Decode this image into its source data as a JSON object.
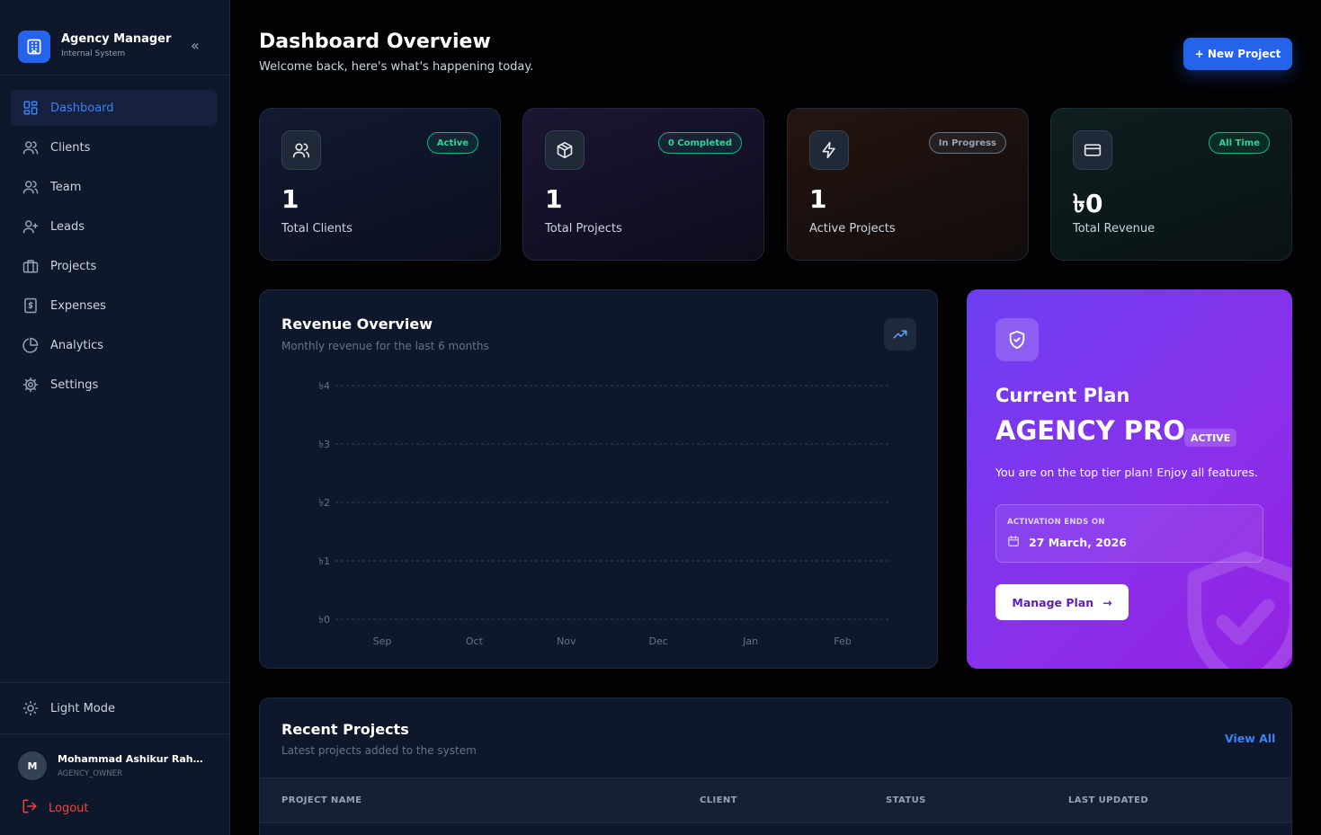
{
  "brand": {
    "title": "Agency Manager",
    "subtitle": "Internal System",
    "collapse_glyph": "«"
  },
  "nav": [
    {
      "label": "Dashboard",
      "icon": "dashboard-icon"
    },
    {
      "label": "Clients",
      "icon": "users-icon"
    },
    {
      "label": "Team",
      "icon": "users-icon"
    },
    {
      "label": "Leads",
      "icon": "user-plus-icon"
    },
    {
      "label": "Projects",
      "icon": "briefcase-icon"
    },
    {
      "label": "Expenses",
      "icon": "receipt-icon"
    },
    {
      "label": "Analytics",
      "icon": "pie-chart-icon"
    },
    {
      "label": "Settings",
      "icon": "gear-icon"
    }
  ],
  "active_nav": "Dashboard",
  "theme_toggle": {
    "label": "Light Mode"
  },
  "user": {
    "initial": "M",
    "name": "Mohammad Ashikur Rahman ...",
    "role": "AGENCY_OWNER"
  },
  "logout": {
    "label": "Logout"
  },
  "header": {
    "title": "Dashboard Overview",
    "subtitle": "Welcome back, here's what's happening today.",
    "new_button": "+ New Project"
  },
  "stats": [
    {
      "value": "1",
      "label": "Total Clients",
      "badge": "Active",
      "icon": "users-icon"
    },
    {
      "value": "1",
      "label": "Total Projects",
      "badge": "0 Completed",
      "icon": "box-icon"
    },
    {
      "value": "1",
      "label": "Active Projects",
      "badge": "In Progress",
      "icon": "lightning-icon"
    },
    {
      "value": "৳0",
      "label": "Total Revenue",
      "badge": "All Time",
      "icon": "credit-card-icon"
    }
  ],
  "revenue": {
    "title": "Revenue Overview",
    "subtitle": "Monthly revenue for the last 6 months"
  },
  "chart_data": {
    "type": "line",
    "categories": [
      "Sep",
      "Oct",
      "Nov",
      "Dec",
      "Jan",
      "Feb"
    ],
    "values": [
      0,
      0,
      0,
      0,
      0,
      0
    ],
    "y_ticks": [
      "৳4",
      "৳3",
      "৳2",
      "৳1",
      "৳0"
    ],
    "ylim": [
      0,
      4
    ],
    "grid": true
  },
  "plan": {
    "heading": "Current Plan",
    "name": "AGENCY PRO",
    "status": "ACTIVE",
    "description": "You are on the top tier plan! Enjoy all features.",
    "activation_label": "ACTIVATION ENDS ON",
    "activation_date": "27 March, 2026",
    "manage_button": "Manage Plan",
    "arrow": "→"
  },
  "recent": {
    "title": "Recent Projects",
    "subtitle": "Latest projects added to the system",
    "view_all": "View All",
    "columns": [
      "PROJECT NAME",
      "CLIENT",
      "STATUS",
      "LAST UPDATED"
    ]
  },
  "colors": {
    "accent": "#2563eb",
    "sidebar_bg": "#0f172a",
    "page_bg": "#020204",
    "plan_gradient_start": "#6d3ff2",
    "plan_gradient_end": "#9421e2",
    "badge_green": "#34d399",
    "logout_red": "#ef4444"
  }
}
